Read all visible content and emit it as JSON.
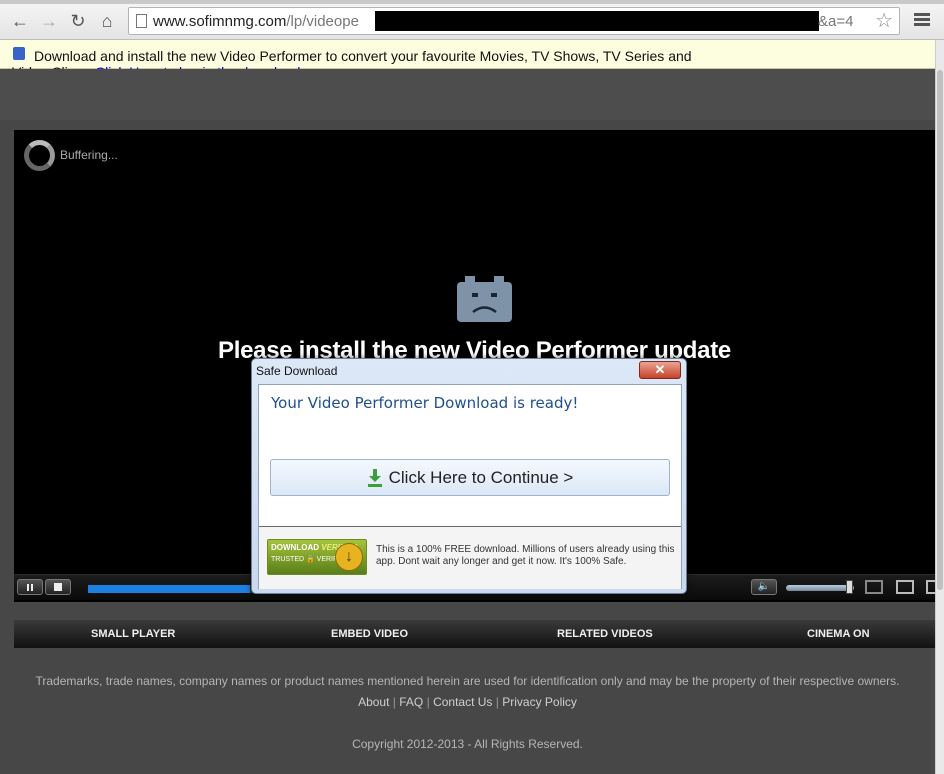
{
  "browser": {
    "url_host": "www.sofimnmg.com",
    "url_path": "/lp/videope",
    "url_tail": "&a=4"
  },
  "infobar": {
    "message": "Download and install the new Video Performer to convert your favourite Movies, TV Shows, TV Series and",
    "message_cont": "Video Clips -",
    "link": "Click Here to begin the download"
  },
  "player": {
    "buffering": "Buffering...",
    "headline": "Please install the new Video Performer update",
    "progress_fraction": 0.58
  },
  "dialog": {
    "title": "Safe Download",
    "close": "✕",
    "ready": "Your Video Performer Download is ready!",
    "continue_label": "Click Here to Continue >",
    "badge_line1": "DOWNLOAD",
    "badge_line1b": "VERIFIED",
    "badge_line2": "TRUSTED 🔒 VERIFIED",
    "fine_print": "This is a 100% FREE download. Millions of users already using this app. Dont wait any longer and get it now. It's 100% Safe."
  },
  "nav": {
    "small_player": "SMALL PLAYER",
    "embed_video": "EMBED VIDEO",
    "related_videos": "RELATED VIDEOS",
    "cinema_on": "CINEMA ON"
  },
  "footer": {
    "trademarks": "Trademarks, trade names, company names or product names mentioned herein are used for identification only and may be the property of their respective owners.",
    "about": "About",
    "faq": "FAQ",
    "contact": "Contact Us",
    "privacy": "Privacy Policy",
    "copyright": "Copyright 2012-2013 - All Rights Reserved."
  }
}
